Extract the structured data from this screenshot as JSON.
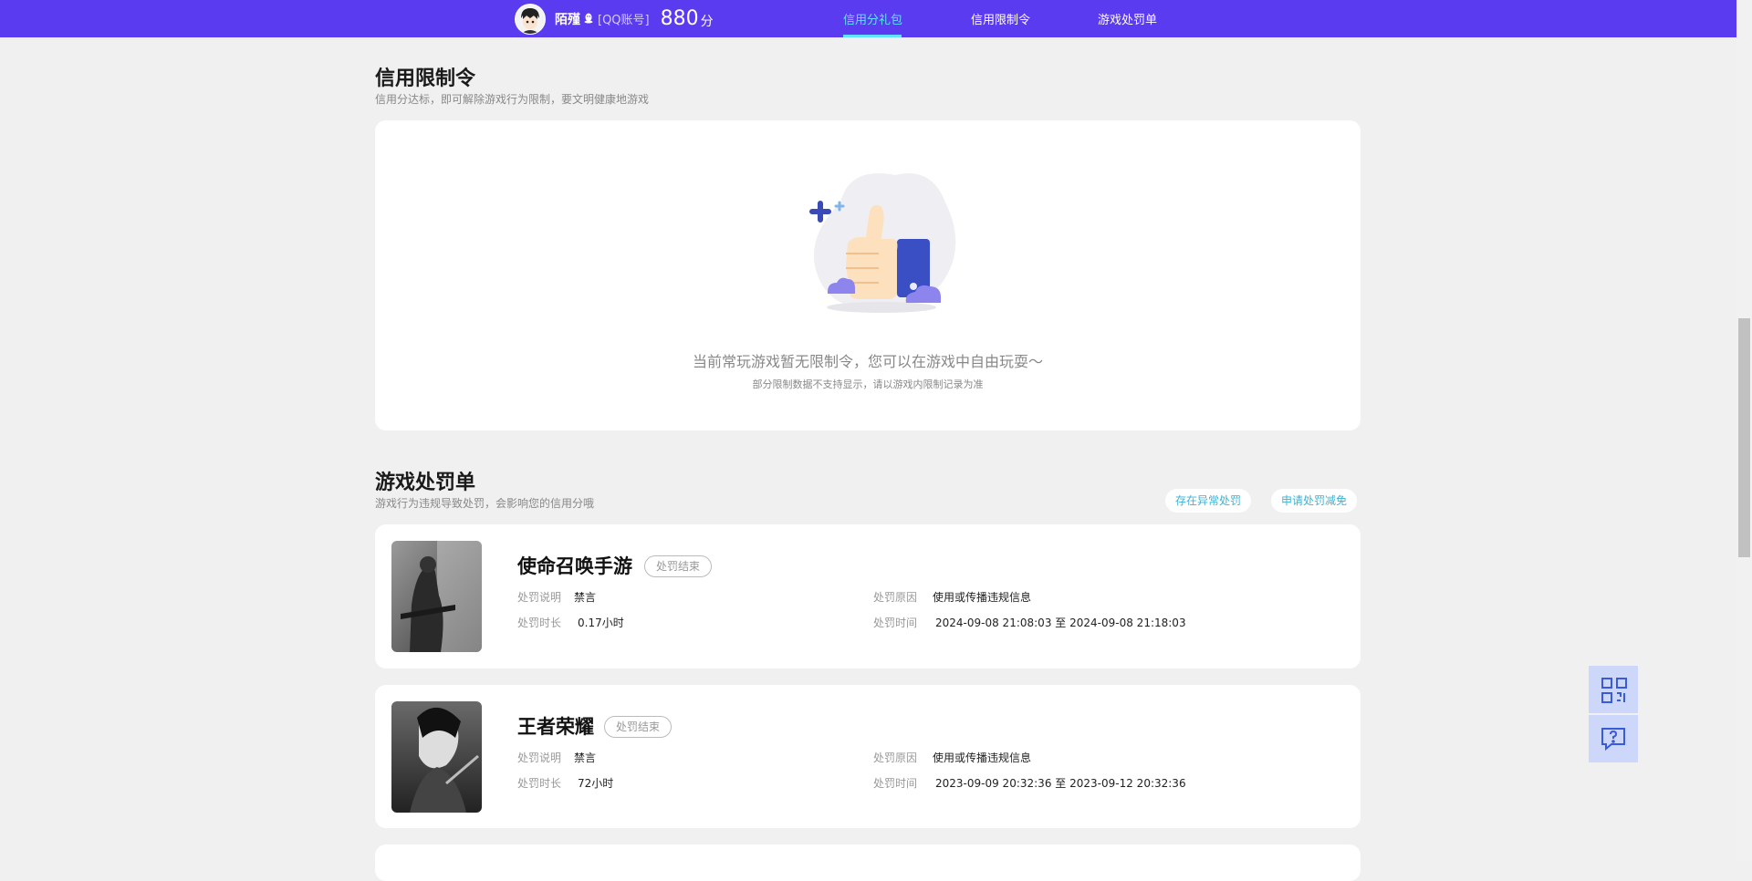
{
  "header": {
    "user_name": "陌殣",
    "account_type": "[QQ账号]",
    "score": "880",
    "score_unit": "分",
    "nav": [
      {
        "label": "信用分礼包",
        "active": true
      },
      {
        "label": "信用限制令",
        "active": false
      },
      {
        "label": "游戏处罚单",
        "active": false
      }
    ]
  },
  "restriction": {
    "title": "信用限制令",
    "subtitle": "信用分达标，即可解除游戏行为限制，要文明健康地游戏",
    "empty_message": "当前常玩游戏暂无限制令，您可以在游戏中自由玩耍～",
    "empty_note": "部分限制数据不支持显示，请以游戏内限制记录为准"
  },
  "penalty": {
    "title": "游戏处罚单",
    "subtitle": "游戏行为违规导致处罚，会影响您的信用分哦",
    "buttons": [
      "存在异常处罚",
      "申请处罚减免"
    ],
    "labels": {
      "desc": "处罚说明",
      "duration": "处罚时长",
      "reason": "处罚原因",
      "time": "处罚时间",
      "to": "至"
    },
    "items": [
      {
        "game": "使命召唤手游",
        "status": "处罚结束",
        "desc": "禁言",
        "duration": "0.17小时",
        "reason": "使用或传播违规信息",
        "start": "2024-09-08 21:08:03",
        "end": "2024-09-08 21:18:03"
      },
      {
        "game": "王者荣耀",
        "status": "处罚结束",
        "desc": "禁言",
        "duration": "72小时",
        "reason": "使用或传播违规信息",
        "start": "2023-09-09 20:32:36",
        "end": "2023-09-12 20:32:36"
      }
    ]
  },
  "float": {
    "icons": [
      "qrcode-icon",
      "feedback-icon"
    ]
  }
}
